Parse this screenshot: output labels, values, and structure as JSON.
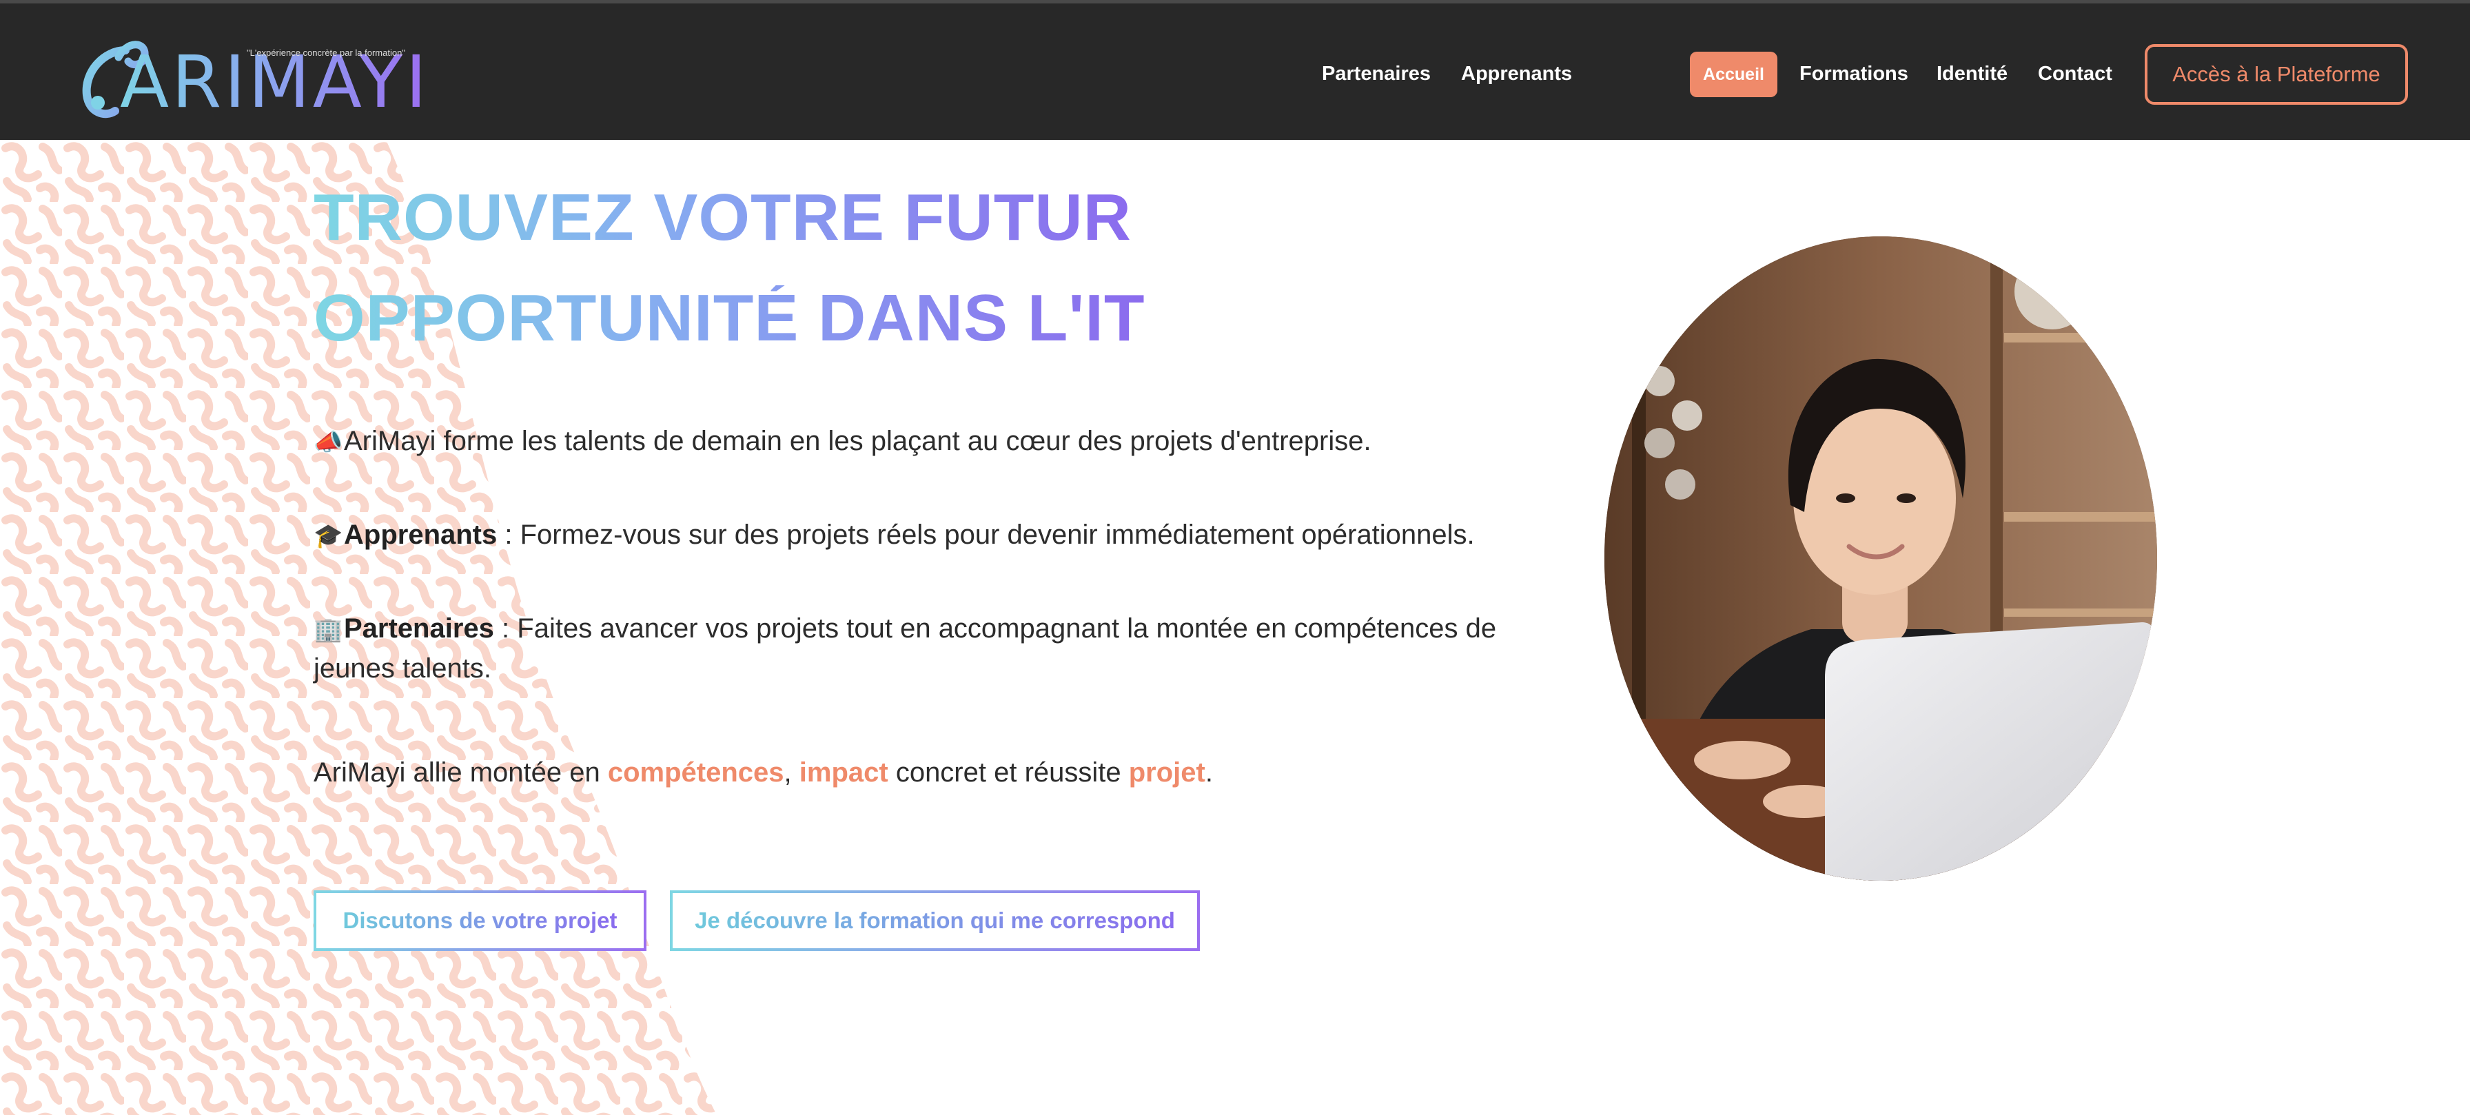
{
  "nav": {
    "logo_text": "ARIMAYI",
    "logo_tagline": "\"L'expérience concrète par la formation\"",
    "links": [
      "Partenaires",
      "Apprenants",
      "Accueil",
      "Formations",
      "Identité",
      "Contact"
    ],
    "cta": "Accès à la Plateforme",
    "active_color": "#ef8a6a"
  },
  "hero": {
    "headline_line1": "TROUVEZ VOTRE FUTUR",
    "headline_line2": "OPPORTUNITÉ DANS L'IT",
    "p1_icon": "megaphone-icon",
    "p1_text": "AriMayi forme les talents de demain en les plaçant au cœur des projets d'entreprise.",
    "p2_icon": "graduate-icon",
    "p2_label": "Apprenants",
    "p2_text": " : Formez-vous sur des projets réels pour devenir immédiatement opérationnels.",
    "p3_icon": "office-building-icon",
    "p3_label": "Partenaires",
    "p3_text": " : Faites avancer vos projets tout en accompagnant la montée en compétences de jeunes talents.",
    "p4_start": "AriMayi allie montée en ",
    "p4_w1": "compétences",
    "p4_sep": ", ",
    "p4_w2": "impact",
    "p4_mid": " concret et réussite ",
    "p4_w3": "projet",
    "p4_end": ".",
    "btn_primary": "Discutons de votre projet",
    "btn_secondary": "Je découvre la formation qui me correspond"
  },
  "colors": {
    "accent": "#ef8a6a",
    "gradient_start": "#7ed6e3",
    "gradient_end": "#8b6bee",
    "nav_bg": "#282828"
  }
}
